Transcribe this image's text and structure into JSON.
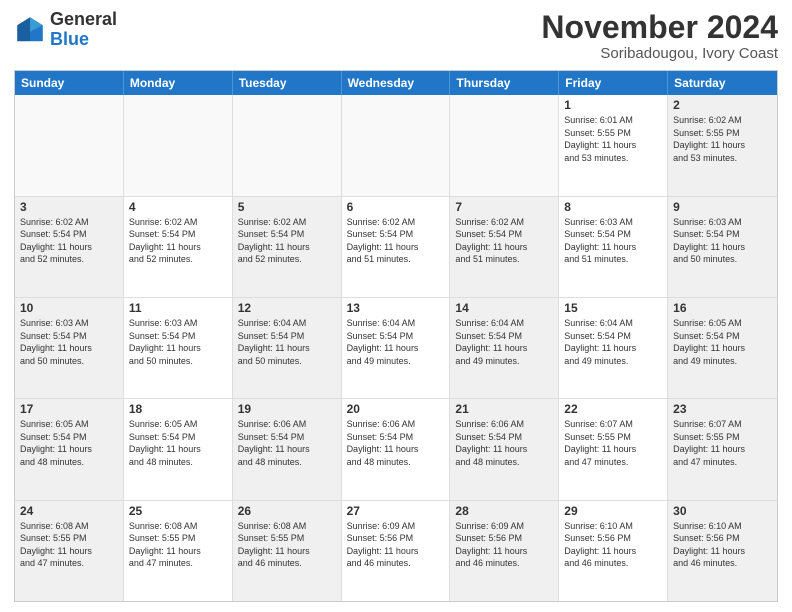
{
  "header": {
    "logo": {
      "general": "General",
      "blue": "Blue"
    },
    "title": "November 2024",
    "location": "Soribadougou, Ivory Coast"
  },
  "calendar": {
    "days_of_week": [
      "Sunday",
      "Monday",
      "Tuesday",
      "Wednesday",
      "Thursday",
      "Friday",
      "Saturday"
    ],
    "weeks": [
      [
        {
          "day": "",
          "info": "",
          "empty": true
        },
        {
          "day": "",
          "info": "",
          "empty": true
        },
        {
          "day": "",
          "info": "",
          "empty": true
        },
        {
          "day": "",
          "info": "",
          "empty": true
        },
        {
          "day": "",
          "info": "",
          "empty": true
        },
        {
          "day": "1",
          "info": "Sunrise: 6:01 AM\nSunset: 5:55 PM\nDaylight: 11 hours\nand 53 minutes.",
          "empty": false
        },
        {
          "day": "2",
          "info": "Sunrise: 6:02 AM\nSunset: 5:55 PM\nDaylight: 11 hours\nand 53 minutes.",
          "empty": false
        }
      ],
      [
        {
          "day": "3",
          "info": "Sunrise: 6:02 AM\nSunset: 5:54 PM\nDaylight: 11 hours\nand 52 minutes.",
          "empty": false
        },
        {
          "day": "4",
          "info": "Sunrise: 6:02 AM\nSunset: 5:54 PM\nDaylight: 11 hours\nand 52 minutes.",
          "empty": false
        },
        {
          "day": "5",
          "info": "Sunrise: 6:02 AM\nSunset: 5:54 PM\nDaylight: 11 hours\nand 52 minutes.",
          "empty": false
        },
        {
          "day": "6",
          "info": "Sunrise: 6:02 AM\nSunset: 5:54 PM\nDaylight: 11 hours\nand 51 minutes.",
          "empty": false
        },
        {
          "day": "7",
          "info": "Sunrise: 6:02 AM\nSunset: 5:54 PM\nDaylight: 11 hours\nand 51 minutes.",
          "empty": false
        },
        {
          "day": "8",
          "info": "Sunrise: 6:03 AM\nSunset: 5:54 PM\nDaylight: 11 hours\nand 51 minutes.",
          "empty": false
        },
        {
          "day": "9",
          "info": "Sunrise: 6:03 AM\nSunset: 5:54 PM\nDaylight: 11 hours\nand 50 minutes.",
          "empty": false
        }
      ],
      [
        {
          "day": "10",
          "info": "Sunrise: 6:03 AM\nSunset: 5:54 PM\nDaylight: 11 hours\nand 50 minutes.",
          "empty": false
        },
        {
          "day": "11",
          "info": "Sunrise: 6:03 AM\nSunset: 5:54 PM\nDaylight: 11 hours\nand 50 minutes.",
          "empty": false
        },
        {
          "day": "12",
          "info": "Sunrise: 6:04 AM\nSunset: 5:54 PM\nDaylight: 11 hours\nand 50 minutes.",
          "empty": false
        },
        {
          "day": "13",
          "info": "Sunrise: 6:04 AM\nSunset: 5:54 PM\nDaylight: 11 hours\nand 49 minutes.",
          "empty": false
        },
        {
          "day": "14",
          "info": "Sunrise: 6:04 AM\nSunset: 5:54 PM\nDaylight: 11 hours\nand 49 minutes.",
          "empty": false
        },
        {
          "day": "15",
          "info": "Sunrise: 6:04 AM\nSunset: 5:54 PM\nDaylight: 11 hours\nand 49 minutes.",
          "empty": false
        },
        {
          "day": "16",
          "info": "Sunrise: 6:05 AM\nSunset: 5:54 PM\nDaylight: 11 hours\nand 49 minutes.",
          "empty": false
        }
      ],
      [
        {
          "day": "17",
          "info": "Sunrise: 6:05 AM\nSunset: 5:54 PM\nDaylight: 11 hours\nand 48 minutes.",
          "empty": false
        },
        {
          "day": "18",
          "info": "Sunrise: 6:05 AM\nSunset: 5:54 PM\nDaylight: 11 hours\nand 48 minutes.",
          "empty": false
        },
        {
          "day": "19",
          "info": "Sunrise: 6:06 AM\nSunset: 5:54 PM\nDaylight: 11 hours\nand 48 minutes.",
          "empty": false
        },
        {
          "day": "20",
          "info": "Sunrise: 6:06 AM\nSunset: 5:54 PM\nDaylight: 11 hours\nand 48 minutes.",
          "empty": false
        },
        {
          "day": "21",
          "info": "Sunrise: 6:06 AM\nSunset: 5:54 PM\nDaylight: 11 hours\nand 48 minutes.",
          "empty": false
        },
        {
          "day": "22",
          "info": "Sunrise: 6:07 AM\nSunset: 5:55 PM\nDaylight: 11 hours\nand 47 minutes.",
          "empty": false
        },
        {
          "day": "23",
          "info": "Sunrise: 6:07 AM\nSunset: 5:55 PM\nDaylight: 11 hours\nand 47 minutes.",
          "empty": false
        }
      ],
      [
        {
          "day": "24",
          "info": "Sunrise: 6:08 AM\nSunset: 5:55 PM\nDaylight: 11 hours\nand 47 minutes.",
          "empty": false
        },
        {
          "day": "25",
          "info": "Sunrise: 6:08 AM\nSunset: 5:55 PM\nDaylight: 11 hours\nand 47 minutes.",
          "empty": false
        },
        {
          "day": "26",
          "info": "Sunrise: 6:08 AM\nSunset: 5:55 PM\nDaylight: 11 hours\nand 46 minutes.",
          "empty": false
        },
        {
          "day": "27",
          "info": "Sunrise: 6:09 AM\nSunset: 5:56 PM\nDaylight: 11 hours\nand 46 minutes.",
          "empty": false
        },
        {
          "day": "28",
          "info": "Sunrise: 6:09 AM\nSunset: 5:56 PM\nDaylight: 11 hours\nand 46 minutes.",
          "empty": false
        },
        {
          "day": "29",
          "info": "Sunrise: 6:10 AM\nSunset: 5:56 PM\nDaylight: 11 hours\nand 46 minutes.",
          "empty": false
        },
        {
          "day": "30",
          "info": "Sunrise: 6:10 AM\nSunset: 5:56 PM\nDaylight: 11 hours\nand 46 minutes.",
          "empty": false
        }
      ]
    ]
  }
}
